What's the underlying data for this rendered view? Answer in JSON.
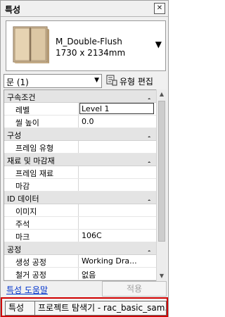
{
  "panel": {
    "title": "특성",
    "close_symbol": "✕"
  },
  "type_selector": {
    "family_name": "M_Double-Flush",
    "dimensions": "1730 x 2134mm",
    "arrow": "▼"
  },
  "filter": {
    "value": "문 (1)",
    "arrow": "▼"
  },
  "edit_type": {
    "label": "유형 편집"
  },
  "groups": [
    {
      "title": "구속조건",
      "chevron": "ꞈ",
      "rows": [
        {
          "name": "레벨",
          "value": "Level 1"
        },
        {
          "name": "씰 높이",
          "value": "0.0"
        }
      ]
    },
    {
      "title": "구성",
      "chevron": "ꞈ",
      "rows": [
        {
          "name": "프레임 유형",
          "value": ""
        }
      ]
    },
    {
      "title": "재료 및 마감재",
      "chevron": "ꞈ",
      "rows": [
        {
          "name": "프레임 재료",
          "value": ""
        },
        {
          "name": "마감",
          "value": ""
        }
      ]
    },
    {
      "title": "ID 데이터",
      "chevron": "ꞈ",
      "rows": [
        {
          "name": "이미지",
          "value": ""
        },
        {
          "name": "주석",
          "value": ""
        },
        {
          "name": "마크",
          "value": "106C"
        }
      ]
    },
    {
      "title": "공정",
      "chevron": "ꞈ",
      "rows": [
        {
          "name": "생성 공정",
          "value": "Working Dra..."
        },
        {
          "name": "철거 공정",
          "value": "없음"
        }
      ]
    }
  ],
  "footer": {
    "help_link": "특성 도움말",
    "apply_label": "적용"
  },
  "tabs": {
    "properties": "특성",
    "project_browser": "프로젝트 탐색기 - rac_basic_sam..."
  },
  "colors": {
    "tab_highlight": "#d00000",
    "link": "#0033cc"
  }
}
